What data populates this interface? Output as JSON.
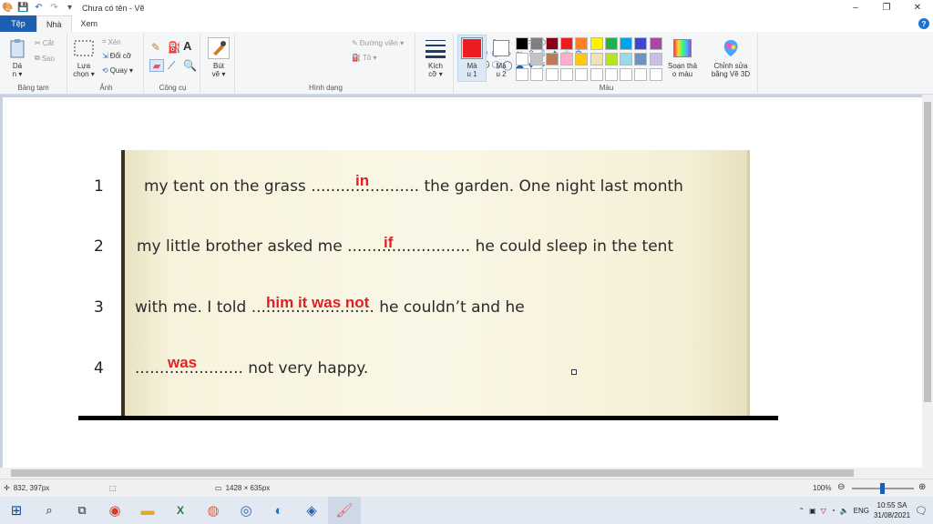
{
  "window": {
    "title": "Chưa có tên - Vẽ",
    "controls": [
      "–",
      "❐",
      "✕"
    ]
  },
  "tabs": [
    {
      "label": "Tệp"
    },
    {
      "label": "Nhà"
    },
    {
      "label": "Xem"
    }
  ],
  "ribbon": {
    "clipboard": {
      "paste": "Dá\nn ▾",
      "cut": "Cắt",
      "copy": "Sao",
      "label": "Bảng tạm"
    },
    "image": {
      "select": "Lựa\nchọn ▾",
      "crop": "Xén",
      "resize": "Đổi cỡ",
      "rotate": "Quay ▾",
      "label": "Ảnh"
    },
    "tools": {
      "label": "Công cụ"
    },
    "brushes": {
      "label": "Bút\nvẽ ▾"
    },
    "shapes": {
      "glyphs": [
        "╲",
        "∿",
        "○",
        "□",
        "▭",
        "◇",
        "△",
        "◣",
        "◇",
        "⬠",
        "⬡",
        "⇨",
        "⇦",
        "⇧",
        "⇩",
        "✦",
        "☆",
        "✡",
        "💬",
        "🗨",
        "◯",
        "☁",
        "♥",
        "⚡"
      ],
      "outline": "Đường viền ▾",
      "fill": "Tô ▾",
      "label": "Hình dạng"
    },
    "size": {
      "label": "Kích\ncỡ ▾"
    },
    "colors": {
      "color1": "Mà\nu 1",
      "color2": "Mà\nu 2",
      "edit_colors": "Soạn thả\no màu",
      "paint3d": "Chỉnh sửa\nbằng Vẽ 3D",
      "label": "Màu",
      "color1_value": "#ed1c24",
      "color2_value": "#ffffff",
      "palette_row1": [
        "#000000",
        "#7f7f7f",
        "#880015",
        "#ed1c24",
        "#ff7f27",
        "#fff200",
        "#22b14c",
        "#00a2e8",
        "#3f48cc",
        "#a349a4"
      ],
      "palette_row2": [
        "#ffffff",
        "#c3c3c3",
        "#b97a57",
        "#ffaec9",
        "#ffc90e",
        "#efe4b0",
        "#b5e61d",
        "#99d9ea",
        "#7092be",
        "#c8bfe7"
      ],
      "palette_row3": [
        "#ffffff",
        "#ffffff",
        "#ffffff",
        "#ffffff",
        "#ffffff",
        "#ffffff",
        "#ffffff",
        "#ffffff",
        "#ffffff",
        "#ffffff"
      ]
    }
  },
  "worksheet": {
    "rows": [
      {
        "num": "1",
        "text": "my tent on the grass ...................... the garden. One night last month",
        "answer": "in"
      },
      {
        "num": "2",
        "text": "my little brother asked me ......................... he could sleep in the tent",
        "answer": "if"
      },
      {
        "num": "3",
        "text": "with me.  I told ......................... he couldn’t and he",
        "answer": "him it was not"
      },
      {
        "num": "4",
        "text": "...................... not very happy.",
        "answer": "was"
      }
    ]
  },
  "status": {
    "cursor": "832, 397px",
    "image_size": "1428 × 635px",
    "zoom": "100%"
  },
  "taskbar": {
    "language": "ENG",
    "time": "10:55 SA",
    "date": "31/08/2021"
  }
}
